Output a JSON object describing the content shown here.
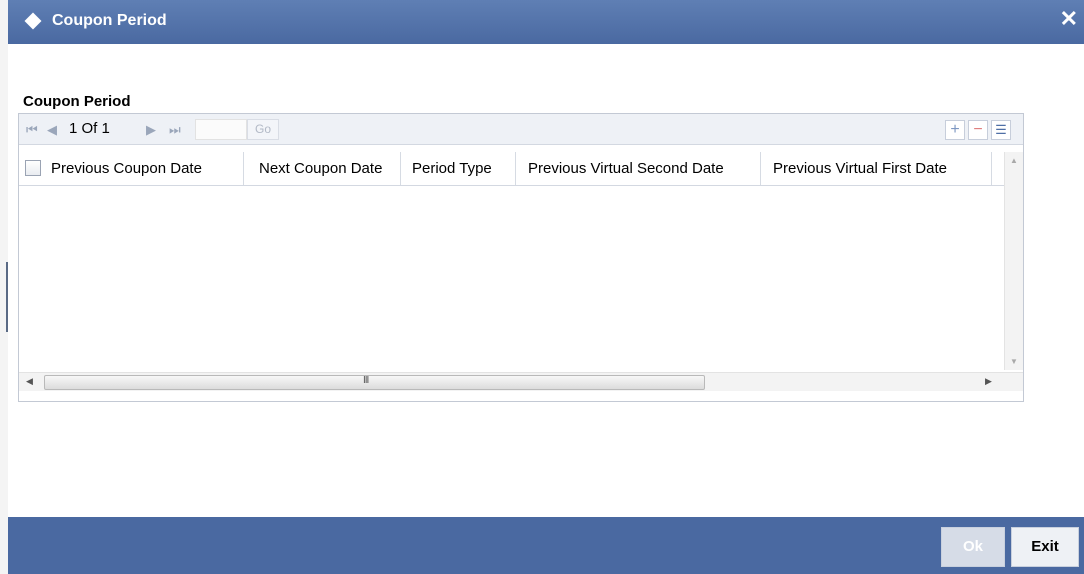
{
  "window": {
    "title": "Coupon Period",
    "close_glyph": "✕"
  },
  "section": {
    "title": "Coupon Period"
  },
  "grid": {
    "pagination": {
      "current": "1",
      "of_label": "Of",
      "total": "1",
      "go_label": "Go"
    },
    "columns": [
      "Previous Coupon Date",
      "Next Coupon Date",
      "Period Type",
      "Previous Virtual Second Date",
      "Previous Virtual First Date"
    ],
    "rows": []
  },
  "footer": {
    "ok_label": "Ok",
    "exit_label": "Exit"
  },
  "colors": {
    "titlebar": "#4a69a1",
    "footer": "#4a69a1"
  },
  "icons": [
    "first-page-icon",
    "prev-page-icon",
    "next-page-icon",
    "last-page-icon",
    "add-row-icon",
    "delete-row-icon",
    "single-view-icon"
  ]
}
